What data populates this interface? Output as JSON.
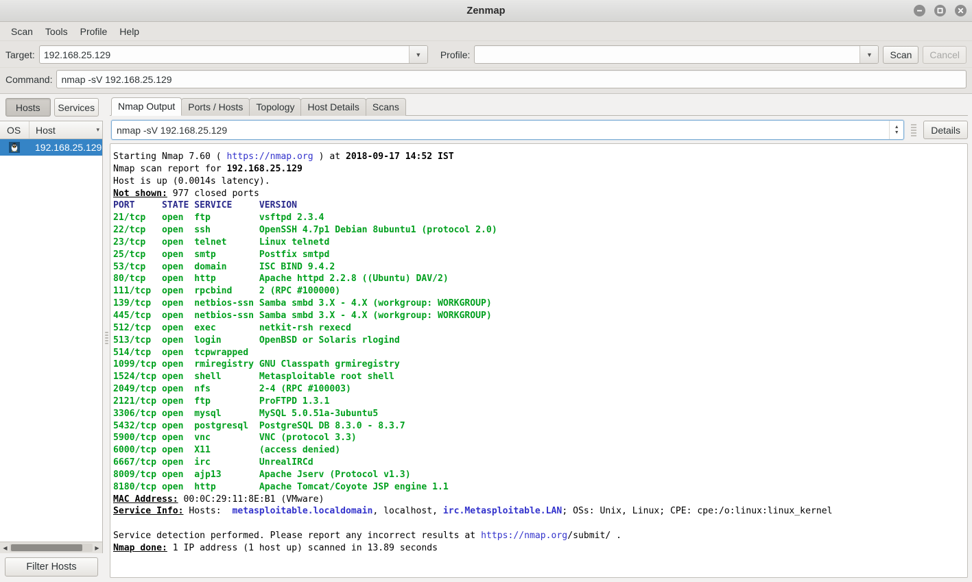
{
  "window": {
    "title": "Zenmap",
    "controls": [
      {
        "name": "minimize-button",
        "glyph": "minimize"
      },
      {
        "name": "maximize-button",
        "glyph": "maximize"
      },
      {
        "name": "close-button",
        "glyph": "close"
      }
    ]
  },
  "menubar": {
    "items": [
      "Scan",
      "Tools",
      "Profile",
      "Help"
    ]
  },
  "toolbar": {
    "target_label": "Target:",
    "target_value": "192.168.25.129",
    "target_placeholder": "",
    "profile_label": "Profile:",
    "profile_value": "",
    "profile_placeholder": "",
    "scan_label": "Scan",
    "cancel_label": "Cancel",
    "command_label": "Command:",
    "command_value": "nmap -sV 192.168.25.129",
    "command_placeholder": "",
    "dropdown_glyph": "▼"
  },
  "sidebar": {
    "tabs": [
      {
        "label": "Hosts",
        "active": true
      },
      {
        "label": "Services",
        "active": false
      }
    ],
    "columns": [
      "OS",
      "Host"
    ],
    "sort_glyph": "▾",
    "hosts": [
      {
        "name": "192.168.25.129",
        "os_icon": "linux-host-icon",
        "selected": true
      }
    ],
    "filter_button": "Filter Hosts",
    "scroll_left_glyph": "◀",
    "scroll_right_glyph": "▶"
  },
  "main": {
    "tabs": [
      {
        "label": "Nmap Output",
        "active": true
      },
      {
        "label": "Ports / Hosts",
        "active": false
      },
      {
        "label": "Topology",
        "active": false
      },
      {
        "label": "Host Details",
        "active": false
      },
      {
        "label": "Scans",
        "active": false
      }
    ],
    "command_selector_value": "nmap -sV 192.168.25.129",
    "details_label": "Details",
    "spinner_up_glyph": "▲",
    "spinner_down_glyph": "▼"
  },
  "output": {
    "lines": [
      [
        {
          "t": "Starting Nmap 7.60 ( ",
          "s": "plain"
        },
        {
          "t": "https://nmap.org",
          "s": "link"
        },
        {
          "t": " ) at ",
          "s": "plain"
        },
        {
          "t": "2018-09-17 14:52 IST",
          "s": "bold"
        }
      ],
      [
        {
          "t": "Nmap scan report for ",
          "s": "plain"
        },
        {
          "t": "192.168.25.129",
          "s": "bold"
        }
      ],
      [
        {
          "t": "Host is up (0.0014s latency).",
          "s": "plain"
        }
      ],
      [
        {
          "t": "Not shown:",
          "s": "uhead"
        },
        {
          "t": " 977 closed ports",
          "s": "plain"
        }
      ],
      [
        {
          "t": "PORT     STATE SERVICE     VERSION",
          "s": "hdr"
        }
      ],
      [
        {
          "t": "21/tcp   open  ftp         vsftpd 2.3.4",
          "s": "port"
        }
      ],
      [
        {
          "t": "22/tcp   open  ssh         OpenSSH 4.7p1 Debian 8ubuntu1 (protocol 2.0)",
          "s": "port"
        }
      ],
      [
        {
          "t": "23/tcp   open  telnet      Linux telnetd",
          "s": "port"
        }
      ],
      [
        {
          "t": "25/tcp   open  smtp        Postfix smtpd",
          "s": "port"
        }
      ],
      [
        {
          "t": "53/tcp   open  domain      ISC BIND 9.4.2",
          "s": "port"
        }
      ],
      [
        {
          "t": "80/tcp   open  http        Apache httpd 2.2.8 ((Ubuntu) DAV/2)",
          "s": "port"
        }
      ],
      [
        {
          "t": "111/tcp  open  rpcbind     2 (RPC #100000)",
          "s": "port"
        }
      ],
      [
        {
          "t": "139/tcp  open  netbios-ssn Samba smbd 3.X - 4.X (workgroup: WORKGROUP)",
          "s": "port"
        }
      ],
      [
        {
          "t": "445/tcp  open  netbios-ssn Samba smbd 3.X - 4.X (workgroup: WORKGROUP)",
          "s": "port"
        }
      ],
      [
        {
          "t": "512/tcp  open  exec        netkit-rsh rexecd",
          "s": "port"
        }
      ],
      [
        {
          "t": "513/tcp  open  login       OpenBSD or Solaris rlogind",
          "s": "port"
        }
      ],
      [
        {
          "t": "514/tcp  open  tcpwrapped",
          "s": "port"
        }
      ],
      [
        {
          "t": "1099/tcp open  rmiregistry GNU Classpath grmiregistry",
          "s": "port"
        }
      ],
      [
        {
          "t": "1524/tcp open  shell       Metasploitable root shell",
          "s": "port"
        }
      ],
      [
        {
          "t": "2049/tcp open  nfs         2-4 (RPC #100003)",
          "s": "port"
        }
      ],
      [
        {
          "t": "2121/tcp open  ftp         ProFTPD 1.3.1",
          "s": "port"
        }
      ],
      [
        {
          "t": "3306/tcp open  mysql       MySQL 5.0.51a-3ubuntu5",
          "s": "port"
        }
      ],
      [
        {
          "t": "5432/tcp open  postgresql  PostgreSQL DB 8.3.0 - 8.3.7",
          "s": "port"
        }
      ],
      [
        {
          "t": "5900/tcp open  vnc         VNC (protocol 3.3)",
          "s": "port"
        }
      ],
      [
        {
          "t": "6000/tcp open  X11         (access denied)",
          "s": "port"
        }
      ],
      [
        {
          "t": "6667/tcp open  irc         UnrealIRCd",
          "s": "port"
        }
      ],
      [
        {
          "t": "8009/tcp open  ajp13       Apache Jserv (Protocol v1.3)",
          "s": "port"
        }
      ],
      [
        {
          "t": "8180/tcp open  http        Apache Tomcat/Coyote JSP engine 1.1",
          "s": "port"
        }
      ],
      [
        {
          "t": "MAC Address:",
          "s": "uhead"
        },
        {
          "t": " 00:0C:29:11:8E:B1 (VMware)",
          "s": "plain"
        }
      ],
      [
        {
          "t": "Service Info:",
          "s": "uhead"
        },
        {
          "t": " Hosts:  ",
          "s": "plain"
        },
        {
          "t": "metasploitable.localdomain",
          "s": "host"
        },
        {
          "t": ", localhost, ",
          "s": "plain"
        },
        {
          "t": "irc.Metasploitable.LAN",
          "s": "host"
        },
        {
          "t": "; OSs: Unix, Linux; CPE: cpe:/o:linux:linux_kernel",
          "s": "plain"
        }
      ],
      [
        {
          "t": "",
          "s": "plain"
        }
      ],
      [
        {
          "t": "Service detection performed. Please report any incorrect results at ",
          "s": "plain"
        },
        {
          "t": "https://nmap.org",
          "s": "link"
        },
        {
          "t": "/submit/ .",
          "s": "plain"
        }
      ],
      [
        {
          "t": "Nmap done:",
          "s": "uhead"
        },
        {
          "t": " 1 IP address (1 host up) scanned in 13.89 seconds",
          "s": "plain"
        }
      ]
    ]
  }
}
